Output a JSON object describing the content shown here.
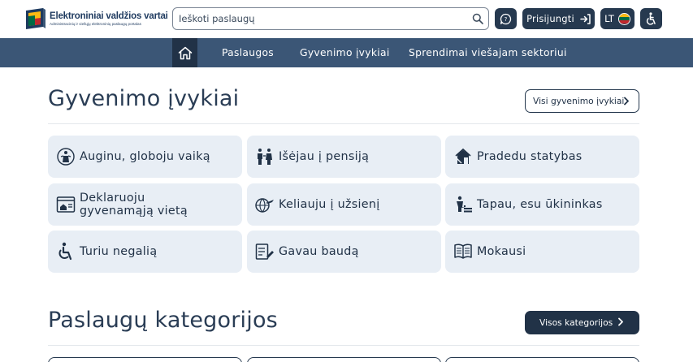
{
  "header": {
    "logo_title": "Elektroniniai valdžios vartai",
    "logo_subtitle": "Administracinių ir viešųjų elektroninių paslaugų portalas",
    "search_placeholder": "Ieškoti paslaugų",
    "login_label": "Prisijungti",
    "lang_label": "LT"
  },
  "nav": {
    "items": [
      {
        "label": "Paslaugos"
      },
      {
        "label": "Gyvenimo įvykiai"
      },
      {
        "label": "Sprendimai viešajam sektoriui"
      }
    ]
  },
  "life_events": {
    "title": "Gyvenimo įvykiai",
    "all_label": "Visi gyvenimo įvykiai",
    "cards": [
      {
        "label": "Auginu, globoju vaiką",
        "icon": "child-care-icon"
      },
      {
        "label": "Išėjau į pensiją",
        "icon": "pension-icon"
      },
      {
        "label": "Pradedu statybas",
        "icon": "construction-icon"
      },
      {
        "label_line1": "Deklaruoju",
        "label_line2": "gyvenamąją vietą",
        "icon": "residence-icon"
      },
      {
        "label": "Keliauju į užsienį",
        "icon": "travel-icon"
      },
      {
        "label": "Tapau, esu ūkininkas",
        "icon": "farmer-icon"
      },
      {
        "label": "Turiu negalią",
        "icon": "disability-icon"
      },
      {
        "label": "Gavau baudą",
        "icon": "fine-icon"
      },
      {
        "label": "Mokausi",
        "icon": "education-icon"
      }
    ]
  },
  "categories": {
    "title": "Paslaugų kategorijos",
    "all_label": "Visos kategorijos"
  },
  "colors": {
    "dark": "#213247",
    "nav": "#3b5676",
    "card_bg": "#e8eef5",
    "flag_yellow": "#fdb913",
    "flag_green": "#006a44",
    "flag_red": "#c1272d"
  }
}
